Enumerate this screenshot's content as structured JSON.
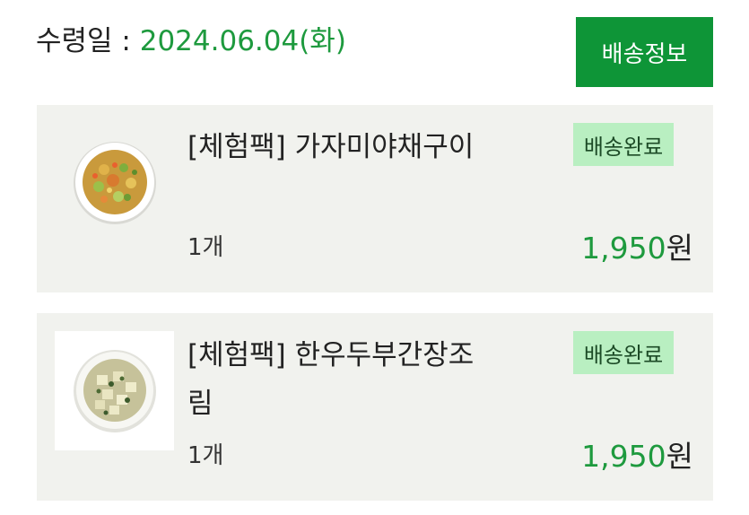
{
  "header": {
    "date_label": "수령일 : ",
    "date_value": "2024.06.04(화)",
    "ship_info_button": "배송정보"
  },
  "orders": [
    {
      "name": "[체험팩] 가자미야채구이",
      "quantity": "1개",
      "status": "배송완료",
      "price": "1,950",
      "currency": "원",
      "icon": "vegetable-bowl-icon"
    },
    {
      "name": "[체험팩] 한우두부간장조림",
      "quantity": "1개",
      "status": "배송완료",
      "price": "1,950",
      "currency": "원",
      "icon": "tofu-bowl-icon"
    }
  ],
  "colors": {
    "accent": "#1e9a3e",
    "button": "#0e9537",
    "badge": "#b9efc1",
    "card": "#f1f2ee"
  }
}
